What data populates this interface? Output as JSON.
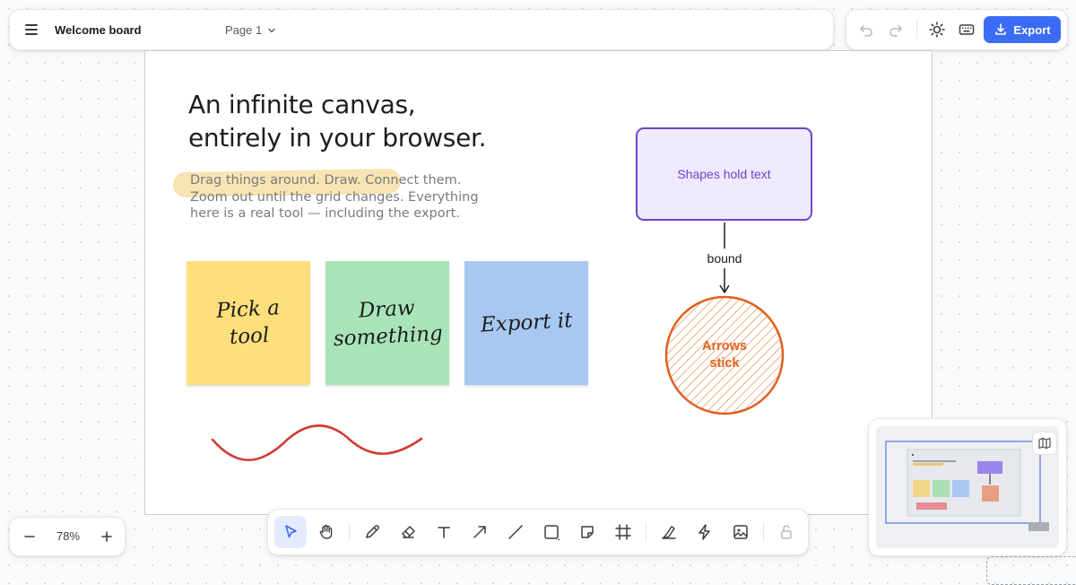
{
  "header": {
    "title": "Welcome board",
    "page_selector": "Page 1"
  },
  "actions": {
    "export_label": "Export"
  },
  "canvas": {
    "headline_line1": "An infinite canvas,",
    "headline_line2": "entirely in your browser.",
    "subtext": "Drag things around. Draw. Connect them. Zoom out until the grid changes. Everything here is a real tool — including the export.",
    "stickies": [
      {
        "line1": "Pick a",
        "line2": "tool",
        "color": "#fddf7c"
      },
      {
        "line1": "Draw",
        "line2": "something",
        "color": "#a9e4b8"
      },
      {
        "line1": "Export it",
        "line2": "",
        "color": "#a8c8f2"
      }
    ],
    "shape_text": "Shapes hold text",
    "arrow_label": "bound",
    "circle_line1": "Arrows",
    "circle_line2": "stick"
  },
  "zoom": {
    "level": "78%"
  },
  "toolbar": {
    "active_tool": "select",
    "tools": [
      "select",
      "hand",
      "pencil",
      "eraser",
      "text",
      "arrow",
      "line",
      "rectangle",
      "sticky-note",
      "frame",
      "highlighter",
      "laser",
      "image",
      "lock"
    ]
  },
  "colors": {
    "accent": "#3b6cf6",
    "shape_stroke": "#6b45c7",
    "circle_stroke": "#e0601c",
    "scribble": "#d23b36"
  }
}
